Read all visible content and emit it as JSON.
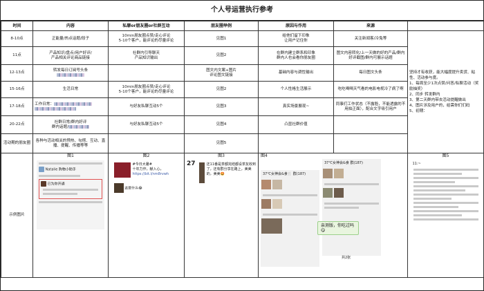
{
  "title": "个人号运营执行参考",
  "headers": [
    "时间",
    "内容",
    "私聊or朋友圈or社群互动",
    "朋友圈举例",
    "原因与作用",
    "来源"
  ],
  "rows": [
    {
      "time": "8-10点",
      "content": "正能量/热点话题/段子",
      "interaction": "10min朋友圈点赞/走心评论\n5-10个客户，能评论的尽量评论",
      "example": "见图1",
      "reason": "给他们留下印象\n让用户记住你",
      "source": "关注新闻客/冷兔等"
    },
    {
      "time": "11点",
      "content": "产品知识/盘点/用户好评/\n产品相关评论商品链接",
      "interaction": "社群内引导聊天\n产品知识输出",
      "example": "见图2",
      "reason": "在群内建立群系和印象\n群内人也会看你朋友圈",
      "source": "图文内容转化/上一天做的好的产品/群内好评截图/群内可展示话题"
    },
    {
      "time": "12-13点",
      "content": "转发每日订阅号头条",
      "interaction": "",
      "example": "图文内文案+图片\n评论图文链接",
      "reason": "基础内容与调性输出",
      "source": "每日图文头条"
    },
    {
      "time": "15-16点",
      "content": "生活日常",
      "interaction": "10min朋友圈点赞/走心评论\n5-10个客户，能评论的尽量评论",
      "example": "见图2",
      "reason": "个人性格生活展示",
      "source": "吃吃喝喝天气看的电影电视冷了病了啊"
    },
    {
      "time": "17-18点",
      "content": "工作日常：",
      "interaction": "与好友私聊互动5个",
      "example": "见图3",
      "reason": "真实场景展现~",
      "source": "同事们工作状态（不露脸，不能透露的不用拍正面），配合文字吸引用户"
    },
    {
      "time": "20-22点",
      "content": "社群日常/群内好评\n群内话题/",
      "interaction": "与好友私聊互动5个",
      "example": "见图4",
      "reason": "凸显社群价值",
      "source": ""
    },
    {
      "time": "活动期的朋友圈",
      "content": "各种与活动相关的预热、勾搭、互动、直播、提醒、传播等等",
      "interaction": "",
      "example": "见图5",
      "reason": "",
      "source": ""
    }
  ],
  "side_note": "坚持才有收获，能大幅度提升卖货、粘性、活动参与度。\n1、每周至少1次点赞/问答/私聊活动（奖励抽奖）\n2、同步           转发群内\n3、第二天群内带去活动提醒做出\n4、图片涉及用户的，给需你们们码\n5、初期：",
  "examples_label": "示例图片",
  "figures": [
    "图1",
    "图2",
    "图3",
    "图4",
    "图5"
  ],
  "fig1": {
    "name_line": "Natalie 购物小助手",
    "badge": "已为你开通"
  },
  "fig2": {
    "title": "#今日大暑#",
    "subtitle": "十年力作，献入心，",
    "link": "https://bit.l/nm8rvwh",
    "caption": "这是什么😂"
  },
  "fig3": {
    "num": "27",
    "text": "还11番是茶都完结都设茶友收到了，还有群分享在路上，美美的，美美🤩"
  },
  "fig4": {
    "a": "37℃女神会&食🍴 群(187)",
    "b": "37℃女神会&食 群(187)",
    "bubble": "亲测版，你吃过吗😋",
    "caption": "共2张"
  },
  "fig5": {
    "time": "11:~"
  }
}
